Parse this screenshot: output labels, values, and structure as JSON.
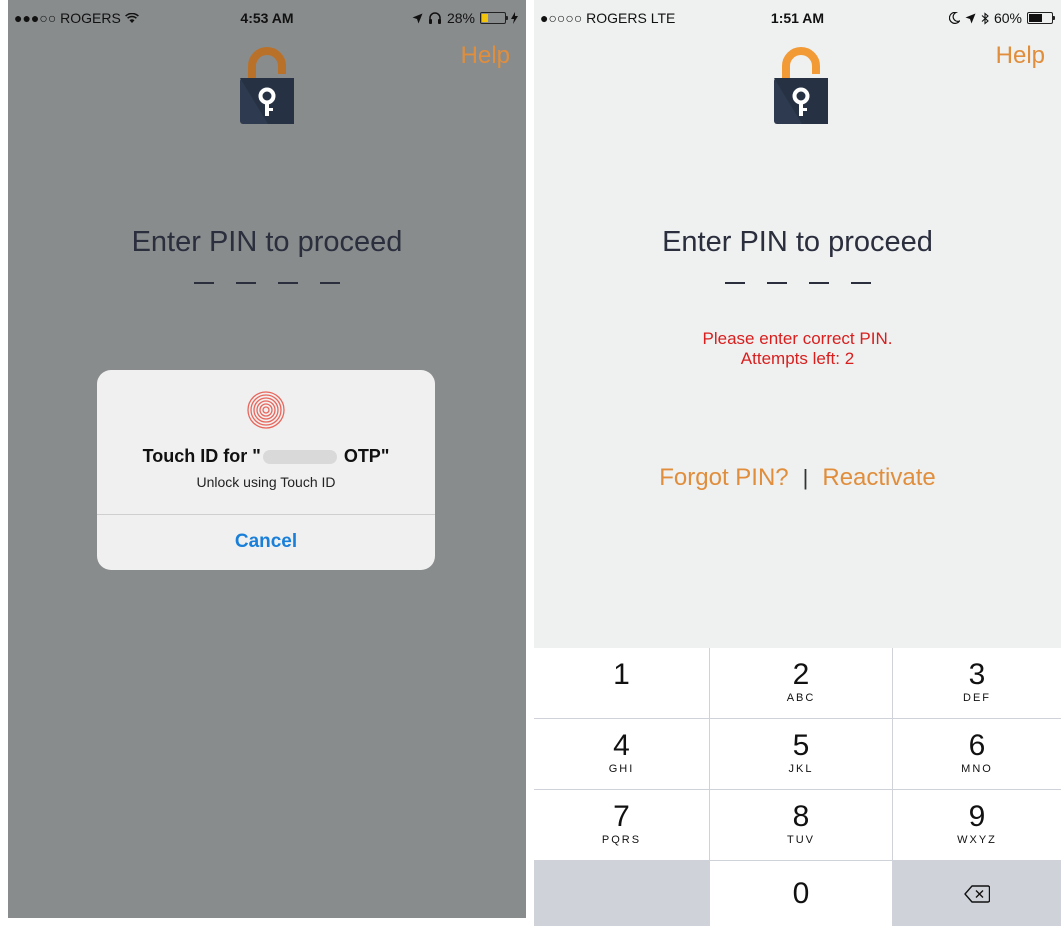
{
  "left_screen": {
    "status": {
      "carrier": "●●●○○ ROGERS",
      "time": "4:53 AM",
      "battery": "28%",
      "battery_level": 0.28
    },
    "help_label": "Help",
    "title": "Enter PIN to proceed",
    "touch_id_dialog": {
      "title_prefix": "Touch ID for \"",
      "title_suffix": " OTP\"",
      "subtitle": "Unlock using Touch ID",
      "cancel_label": "Cancel"
    }
  },
  "right_screen": {
    "status": {
      "carrier": "●○○○○ ROGERS  LTE",
      "time": "1:51 AM",
      "battery": "60%",
      "battery_level": 0.6
    },
    "help_label": "Help",
    "title": "Enter PIN to proceed",
    "error_line1": "Please enter correct PIN.",
    "error_line2": "Attempts left: 2",
    "forgot_pin_label": "Forgot PIN?",
    "divider": "|",
    "reactivate_label": "Reactivate",
    "keypad": [
      {
        "num": "1",
        "letters": ""
      },
      {
        "num": "2",
        "letters": "ABC"
      },
      {
        "num": "3",
        "letters": "DEF"
      },
      {
        "num": "4",
        "letters": "GHI"
      },
      {
        "num": "5",
        "letters": "JKL"
      },
      {
        "num": "6",
        "letters": "MNO"
      },
      {
        "num": "7",
        "letters": "PQRS"
      },
      {
        "num": "8",
        "letters": "TUV"
      },
      {
        "num": "9",
        "letters": "WXYZ"
      },
      {
        "num": "0",
        "letters": ""
      }
    ]
  },
  "colors": {
    "accent_orange": "#e08e3c",
    "error_red": "#d91e1e",
    "ios_blue": "#1a7fd9",
    "lock_body": "#2d3a4f"
  }
}
